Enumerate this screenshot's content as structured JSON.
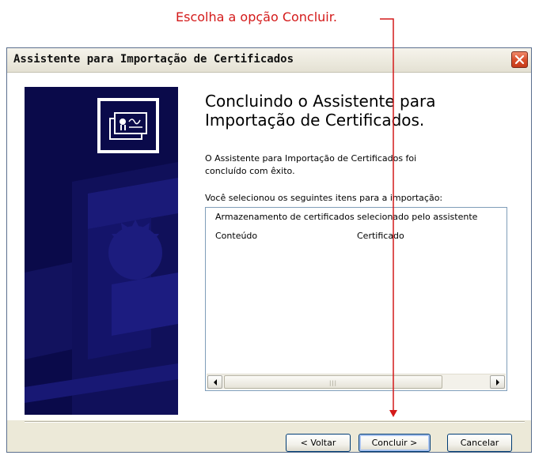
{
  "annotation": {
    "text": "Escolha a opção Concluir.",
    "color": "#d41a1a"
  },
  "window": {
    "title": "Assistente para Importação de Certificados",
    "close_icon": "close-icon"
  },
  "wizard": {
    "heading_line1": "Concluindo o Assistente para",
    "heading_line2": "Importação de Certificados.",
    "desc_line1": "O Assistente para Importação de Certificados foi",
    "desc_line2": "concluído com êxito.",
    "list_label": "Você selecionou os seguintes itens para a importação:",
    "list": {
      "row1": "Armazenamento de certificados selecionado pelo assistente",
      "row2_col1": "Conteúdo",
      "row2_col2": "Certificado"
    },
    "scrollbar": {
      "left_icon": "scroll-left-icon",
      "right_icon": "scroll-right-icon"
    }
  },
  "buttons": {
    "back": "< Voltar",
    "finish": "Concluir >",
    "cancel": "Cancelar"
  },
  "colors": {
    "banner": "#0a0a4a",
    "accent_red": "#d41a1a",
    "button_border": "#003c74"
  }
}
